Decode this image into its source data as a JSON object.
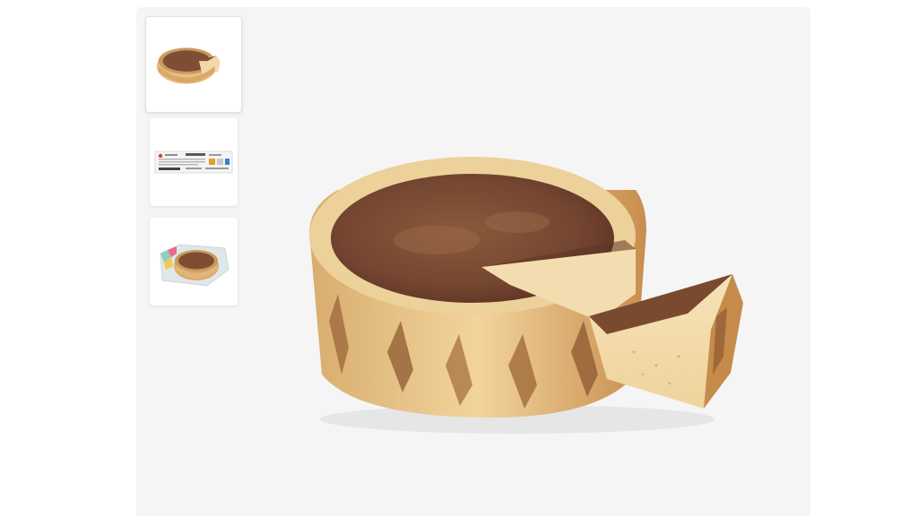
{
  "gallery": {
    "thumbnails": [
      {
        "icon": "cheesecake-thumbnail",
        "selected": true
      },
      {
        "icon": "package-label-thumbnail",
        "selected": false
      },
      {
        "icon": "packaged-cheesecake-thumbnail",
        "selected": false
      }
    ],
    "main_image": {
      "icon": "basque-cheesecake-image"
    }
  },
  "colors": {
    "page_background": "#ffffff",
    "gallery_background": "#f5f5f5",
    "crust": "#e9c78d",
    "burnt_top": "#7a4a30",
    "filling": "#f3ddb0"
  }
}
